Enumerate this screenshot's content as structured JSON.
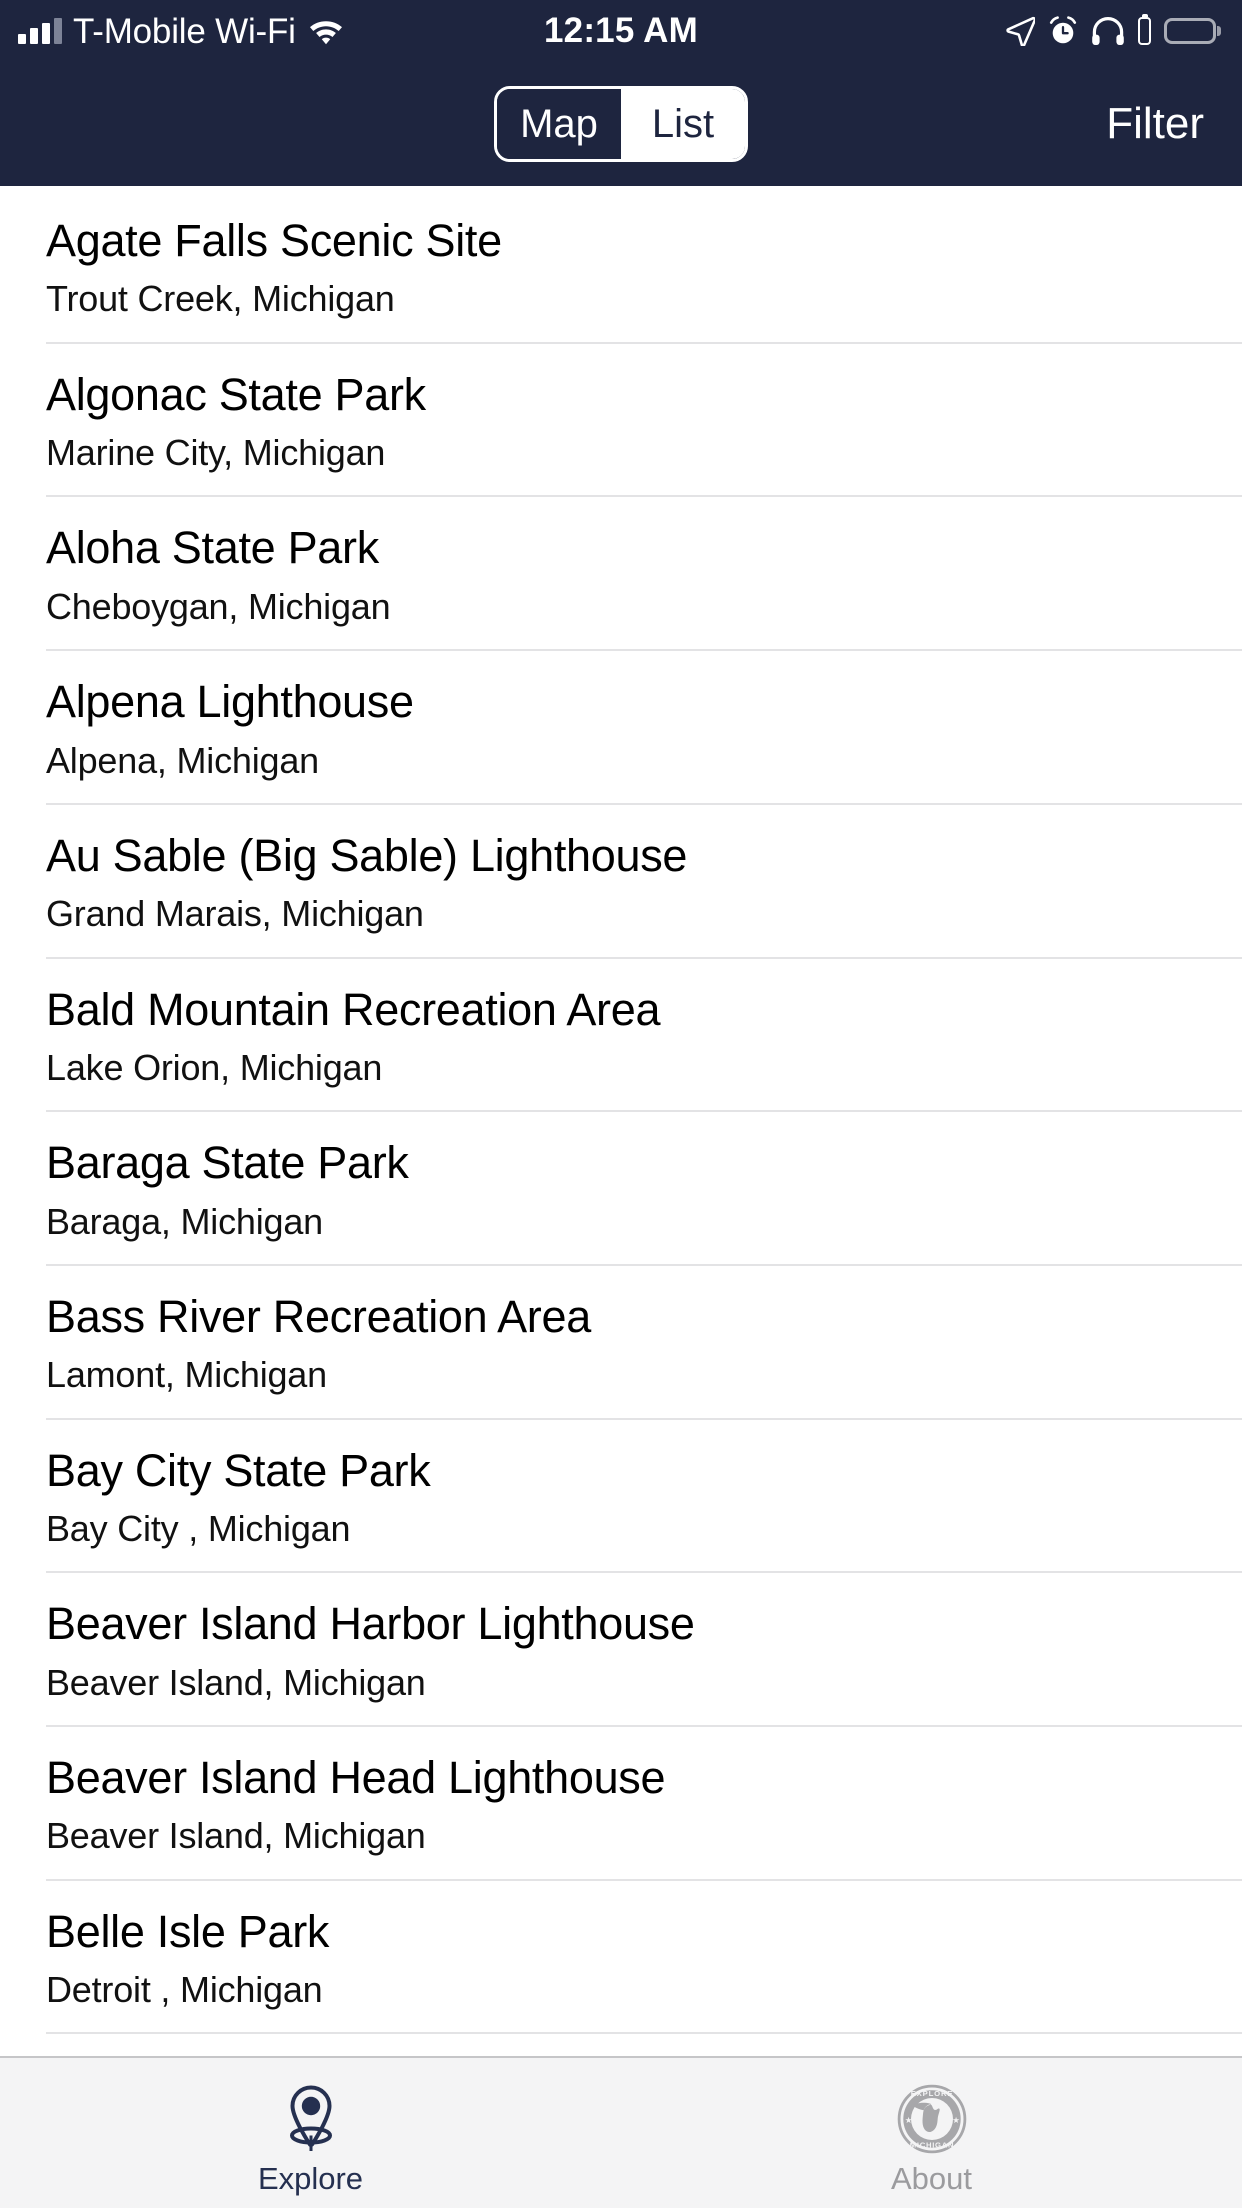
{
  "status_bar": {
    "carrier": "T-Mobile Wi-Fi",
    "time": "12:15 AM",
    "icons": {
      "signal": "cellular-signal-icon",
      "wifi": "wifi-icon",
      "location": "location-arrow-icon",
      "alarm": "alarm-clock-icon",
      "headphones": "headphones-icon",
      "headphone_battery": "headphone-battery-icon",
      "battery": "battery-icon"
    }
  },
  "nav_bar": {
    "segments": [
      {
        "label": "Map",
        "active": false
      },
      {
        "label": "List",
        "active": true
      }
    ],
    "filter_label": "Filter"
  },
  "colors": {
    "navy": "#1e253f",
    "tab_active": "#253050",
    "tab_inactive": "#9b9b9e",
    "divider": "#e3e3e5",
    "tabbar_bg": "#f4f4f5"
  },
  "list": {
    "items": [
      {
        "title": "Agate Falls Scenic Site",
        "subtitle": "Trout Creek, Michigan"
      },
      {
        "title": "Algonac State Park",
        "subtitle": "Marine City, Michigan"
      },
      {
        "title": "Aloha State Park",
        "subtitle": "Cheboygan, Michigan"
      },
      {
        "title": "Alpena Lighthouse",
        "subtitle": "Alpena, Michigan"
      },
      {
        "title": "Au Sable (Big Sable) Lighthouse",
        "subtitle": "Grand Marais, Michigan"
      },
      {
        "title": "Bald Mountain Recreation Area",
        "subtitle": "Lake Orion, Michigan"
      },
      {
        "title": "Baraga State Park",
        "subtitle": "Baraga, Michigan"
      },
      {
        "title": "Bass River Recreation Area",
        "subtitle": "Lamont, Michigan"
      },
      {
        "title": "Bay City State Park",
        "subtitle": "Bay City , Michigan"
      },
      {
        "title": "Beaver Island Harbor Lighthouse",
        "subtitle": "Beaver Island, Michigan"
      },
      {
        "title": "Beaver Island Head Lighthouse",
        "subtitle": "Beaver Island, Michigan"
      },
      {
        "title": "Belle Isle Park",
        "subtitle": "Detroit , Michigan"
      }
    ]
  },
  "tab_bar": {
    "tabs": [
      {
        "label": "Explore",
        "icon": "map-pin-icon",
        "active": true
      },
      {
        "label": "About",
        "icon": "explore-michigan-logo-icon",
        "active": false
      }
    ],
    "logo_text": {
      "top": "EXPLORE",
      "bottom": "MICHIGAN"
    }
  }
}
